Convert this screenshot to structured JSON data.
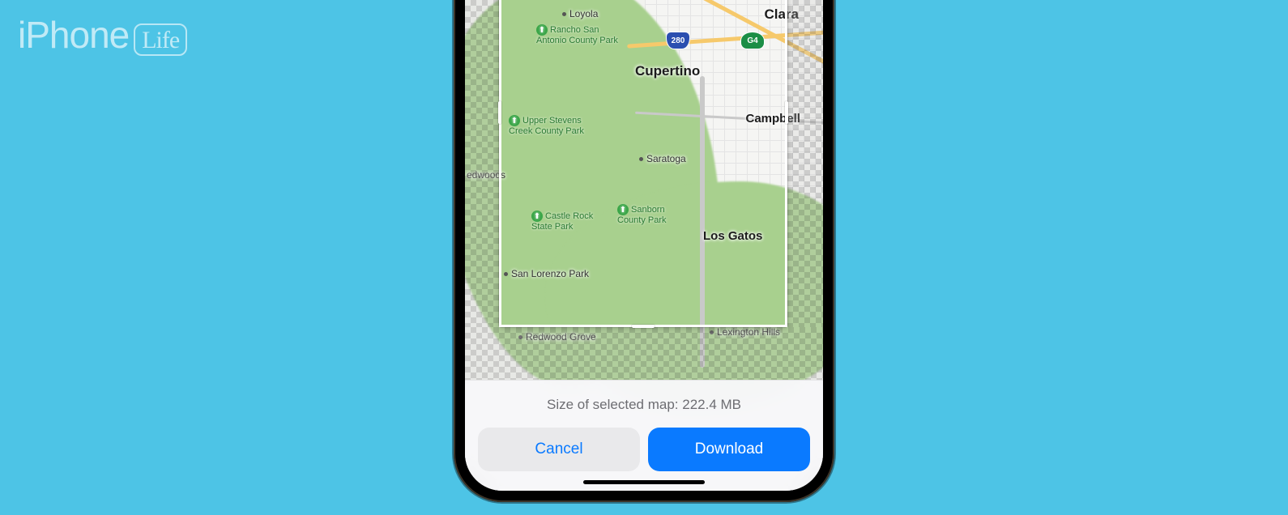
{
  "watermark": {
    "brand_prefix": "iPhone",
    "brand_suffix": "Life"
  },
  "map": {
    "cities": {
      "clara": "Clara",
      "cupertino": "Cupertino",
      "campbell": "Campbell",
      "saratoga": "Saratoga",
      "los_gatos": "Los Gatos",
      "loyola": "Loyola",
      "san_lorenzo_park": "San Lorenzo Park",
      "redwood_grove": "Redwood Grove",
      "lexington_hills": "Lexington Hills",
      "edwoods": "edwoods"
    },
    "parks": {
      "rancho_san_antonio": "Rancho San Antonio County Park",
      "upper_stevens": "Upper Stevens Creek County Park",
      "castle_rock": "Castle Rock State Park",
      "sanborn": "Sanborn County Park"
    },
    "highways": {
      "interstate_280": "280",
      "ca_g4": "G4"
    }
  },
  "sheet": {
    "size_label": "Size of selected map: 222.4 MB",
    "cancel_label": "Cancel",
    "download_label": "Download"
  }
}
